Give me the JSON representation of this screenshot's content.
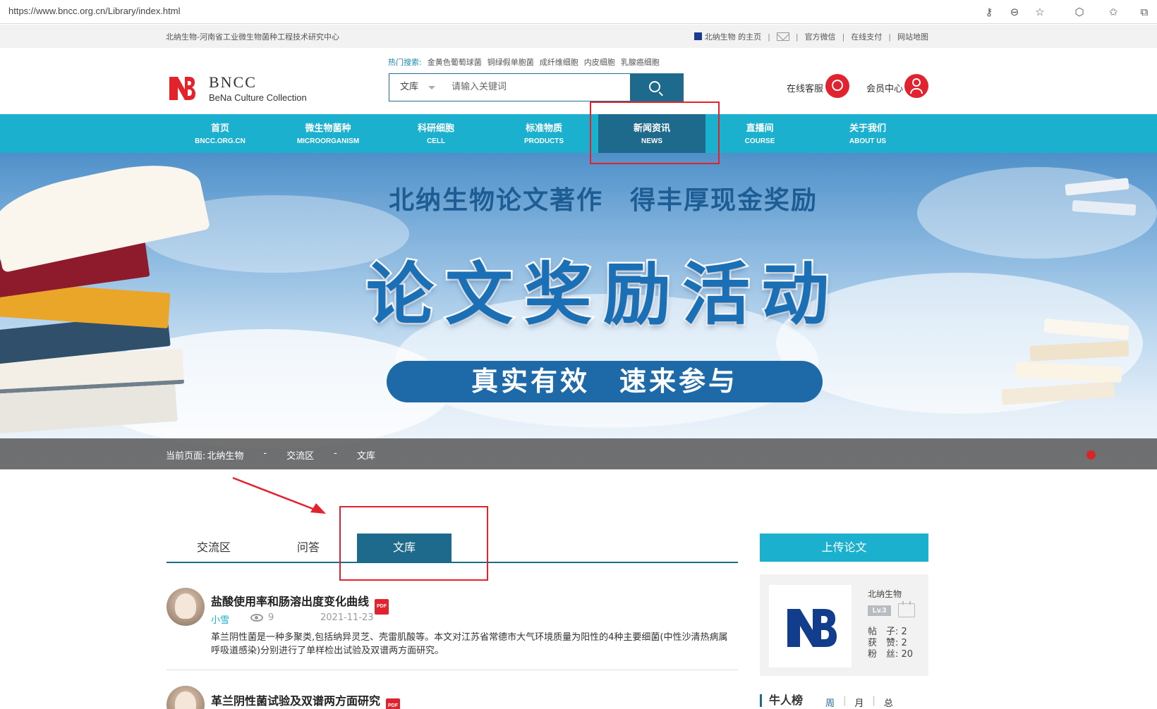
{
  "browser": {
    "url": "https://www.bncc.org.cn/Library/index.html"
  },
  "top_strip": {
    "site_description": "北纳生物-河南省工业微生物菌种工程技术研究中心",
    "homepage_link": "北纳生物 的主页",
    "wechat_link": "官方微信",
    "pay_link": "在线支付",
    "sitemap_link": "网站地图",
    "separator": "|"
  },
  "header": {
    "logo_title": "BNCC",
    "logo_subtitle": "BeNa Culture Collection",
    "hot_label": "热门搜索:",
    "hot_searches": [
      "金黄色葡萄球菌",
      "铜绿假单胞菌",
      "成纤维细胞",
      "内皮细胞",
      "乳腺癌细胞"
    ],
    "search_category": "文库",
    "search_placeholder": "请输入关键词",
    "online_service": "在线客服",
    "member_center": "会员中心"
  },
  "nav": {
    "items": [
      {
        "cn": "首页",
        "en": "BNCC.ORG.CN"
      },
      {
        "cn": "微生物菌种",
        "en": "MICROORGANISM"
      },
      {
        "cn": "科研细胞",
        "en": "CELL"
      },
      {
        "cn": "标准物质",
        "en": "PRODUCTS"
      },
      {
        "cn": "新闻资讯",
        "en": "NEWS"
      },
      {
        "cn": "直播间",
        "en": "COURSE"
      },
      {
        "cn": "关于我们",
        "en": "ABOUT US"
      }
    ]
  },
  "banner": {
    "line1": "北纳生物论文著作　得丰厚现金奖励",
    "line2": "论文奖励活动",
    "pill": "真实有效　速来参与"
  },
  "breadcrumb": {
    "label": "当前页面:",
    "items": [
      "北纳生物",
      "-",
      "交流区",
      "-",
      "文库"
    ]
  },
  "tabs": {
    "items": [
      "交流区",
      "问答",
      "文库"
    ],
    "active": "文库"
  },
  "articles": [
    {
      "title": "盐酸使用率和肠溶出度变化曲线",
      "author": "小雪",
      "views": "9",
      "date": "2021-11-23",
      "summary": "革兰阴性菌是一种多聚类,包括纳异灵芝、壳雷肌酸等。本文对江苏省常德市大气环境质量为阳性的4种主要细菌(中性沙清热病属呼吸道感染)分别进行了单样检出试验及双谱两方面研究。",
      "file_icon": "PDF"
    },
    {
      "title": "革兰阴性菌试验及双谱两方面研究",
      "file_icon": "PDF"
    }
  ],
  "sidebar": {
    "upload_label": "上传论文",
    "profile": {
      "name": "北纳生物",
      "level": "Lv.3",
      "posts": "帖　子: 2",
      "likes": "获　赞: 2",
      "fans": "粉　丝: 20"
    },
    "rank_title": "牛人榜",
    "rank_tabs": [
      "周",
      "月",
      "总"
    ]
  },
  "colors": {
    "nav_bg": "#1ab0ce",
    "nav_active": "#1d6a8c",
    "annotation_red": "#e3222b",
    "brand_red": "#e0232f"
  }
}
